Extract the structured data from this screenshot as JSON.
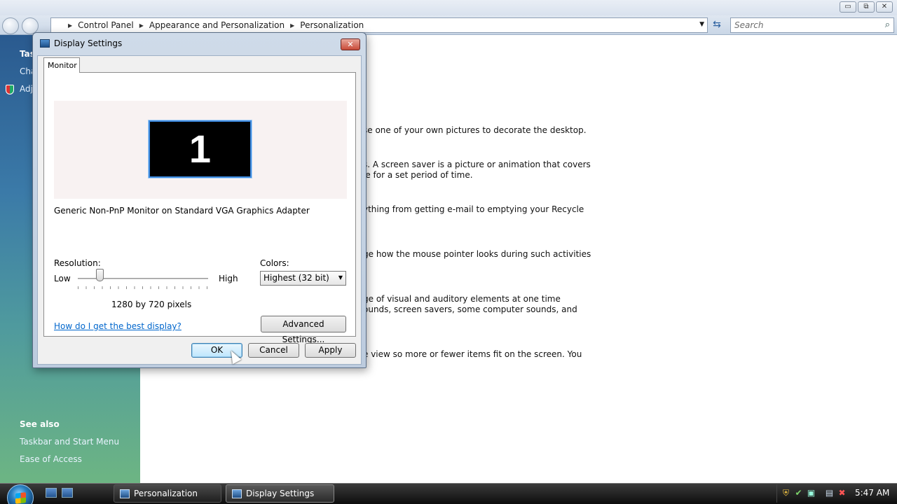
{
  "explorer": {
    "window_controls": {
      "minimize": "▭",
      "maximize": "⧉",
      "close": "✕"
    },
    "breadcrumbs": [
      "Control Panel",
      "Appearance and Personalization",
      "Personalization"
    ],
    "search_placeholder": "Search",
    "left_pane": {
      "tasks_partial": [
        "Tas",
        "Cha",
        "Adj"
      ],
      "see_also_heading": "See also",
      "see_also_links": [
        "Taskbar and Start Menu",
        "Ease of Access"
      ]
    },
    "content_lines": [
      "se one of your own pictures to decorate the desktop.",
      "s. A screen saver is a picture or animation that covers",
      "le for a set period of time.",
      "ything from getting e-mail to emptying your Recycle",
      "ge how the mouse pointer looks during such activities",
      "ge of visual and auditory elements at one time",
      "ounds, screen savers, some computer sounds, and",
      "e view so more or fewer items fit on the screen. You"
    ]
  },
  "dialog": {
    "title": "Display Settings",
    "close_glyph": "✕",
    "tab_label": "Monitor",
    "monitor_number": "1",
    "monitor_description": "Generic Non-PnP Monitor on Standard VGA Graphics Adapter",
    "resolution_label": "Resolution:",
    "low_label": "Low",
    "high_label": "High",
    "slider_position": 0.17,
    "resolution_value": "1280 by 720 pixels",
    "colors_label": "Colors:",
    "colors_selected": "Highest (32 bit)",
    "help_link": "How do I get the best display?",
    "advanced_button": "Advanced Settings...",
    "ok_button": "OK",
    "cancel_button": "Cancel",
    "apply_button": "Apply"
  },
  "taskbar": {
    "tasks": [
      "Personalization",
      "Display Settings"
    ],
    "clock": "5:47 AM"
  },
  "icons": {
    "back": "back-arrow-icon",
    "forward": "forward-arrow-icon",
    "search": "magnifier-icon",
    "shield": "uac-shield-icon",
    "display": "display-settings-icon",
    "start": "windows-logo-icon"
  }
}
